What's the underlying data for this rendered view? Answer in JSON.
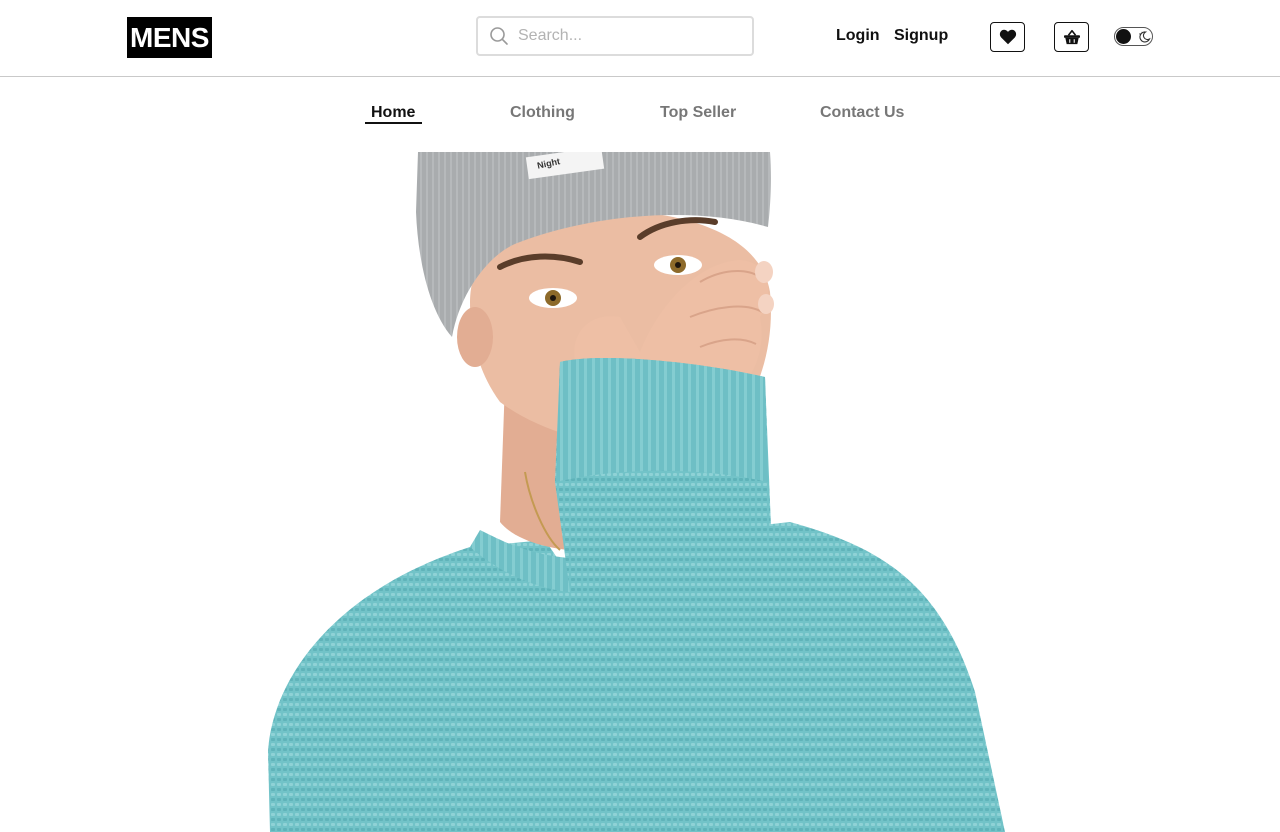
{
  "header": {
    "logo_text": "MENS",
    "search": {
      "placeholder": "Search...",
      "value": ""
    },
    "login_label": "Login",
    "signup_label": "Signup",
    "wishlist_icon": "heart-icon",
    "cart_icon": "basket-icon",
    "theme_toggle": {
      "state": "off",
      "icon": "moon-icon"
    }
  },
  "nav": {
    "items": [
      {
        "label": "Home",
        "active": true
      },
      {
        "label": "Clothing",
        "active": false
      },
      {
        "label": "Top Seller",
        "active": false
      },
      {
        "label": "Contact Us",
        "active": false
      }
    ]
  },
  "hero": {
    "beanie_label": "Night"
  },
  "colors": {
    "accent": "#111111",
    "nav_inactive": "#777777",
    "sweater": "#6ec1c6",
    "beanie": "#a9acae",
    "skin": "#e8b79d"
  }
}
